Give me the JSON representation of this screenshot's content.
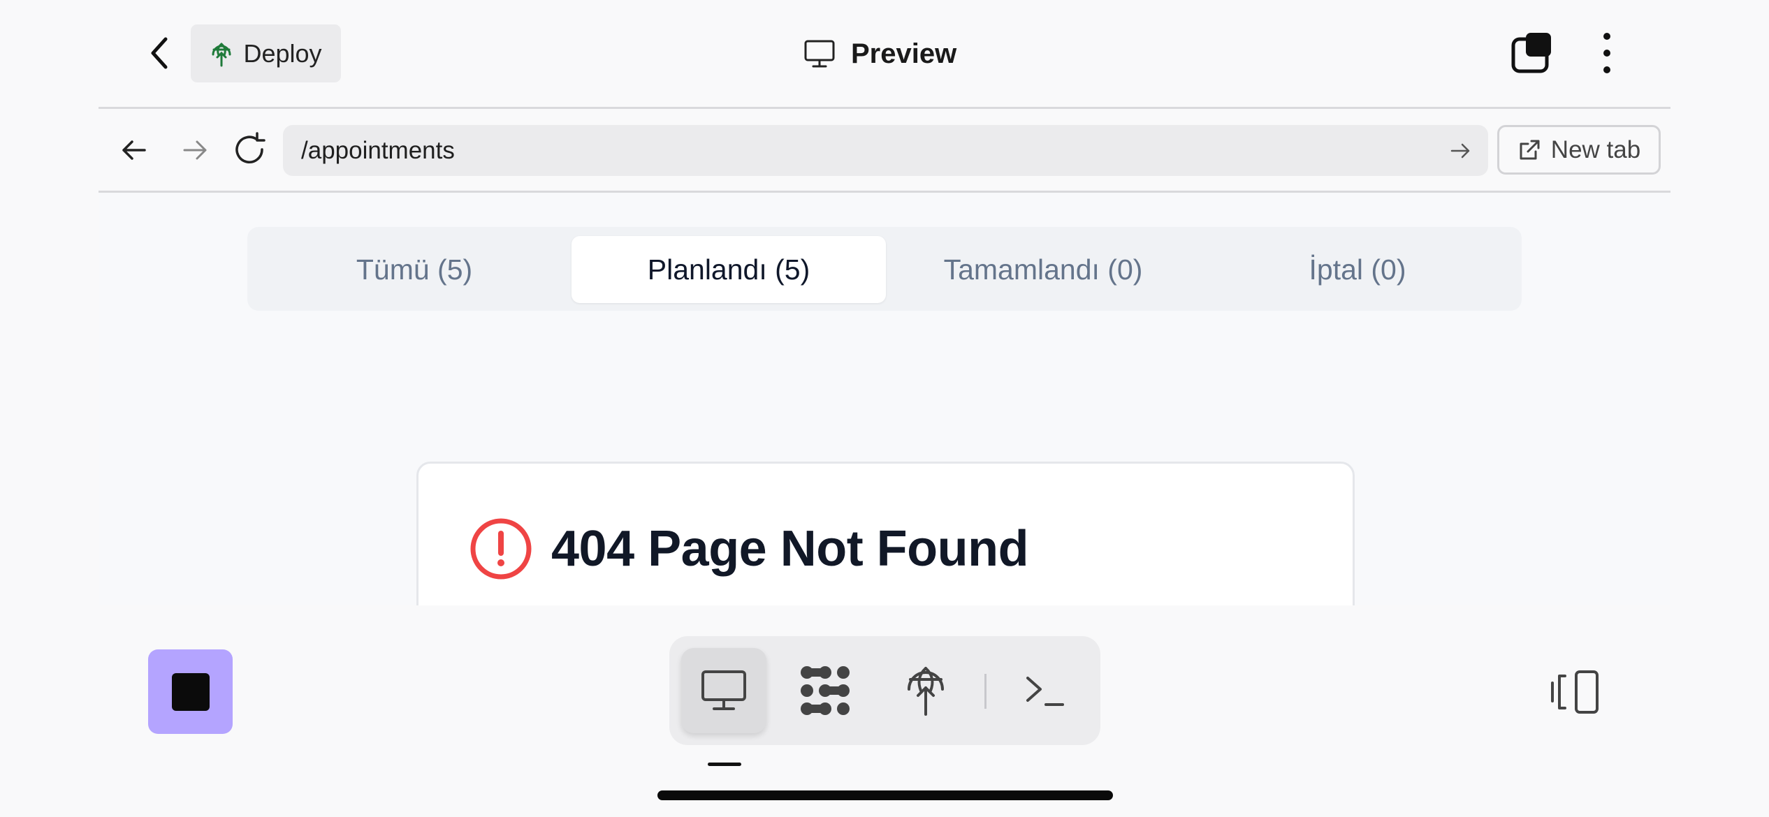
{
  "header": {
    "deploy_label": "Deploy",
    "title": "Preview",
    "icons": {
      "back": "chevron-left-icon",
      "deploy": "deploy-globe-icon",
      "preview": "monitor-icon",
      "tabs": "tabs-icon",
      "more": "more-vertical-icon"
    },
    "colors": {
      "deploy_icon": "#1f7a3a"
    }
  },
  "browser": {
    "url": "/appointments",
    "new_tab_label": "New tab",
    "icons": [
      "arrow-left-icon",
      "arrow-right-icon",
      "reload-icon",
      "go-arrow-icon",
      "external-link-icon"
    ]
  },
  "page": {
    "tabs": [
      {
        "label": "Tümü (5)",
        "active": false
      },
      {
        "label": "Planlandı (5)",
        "active": true
      },
      {
        "label": "Tamamlandı (0)",
        "active": false
      },
      {
        "label": "İptal (0)",
        "active": false
      }
    ],
    "error": {
      "title": "404 Page Not Found",
      "icon": "alert-circle-icon",
      "color": "#ef4444"
    }
  },
  "toolbar": {
    "stop_icon": "stop-icon",
    "stop_color": "#b4a4ff",
    "dock": [
      {
        "name": "preview-monitor-icon",
        "active": true
      },
      {
        "name": "agent-dots-icon",
        "active": false
      },
      {
        "name": "deploy-globe-icon",
        "active": false
      },
      {
        "name": "terminal-prompt-icon",
        "active": false
      }
    ],
    "panel_icon": "panel-toggle-icon"
  }
}
